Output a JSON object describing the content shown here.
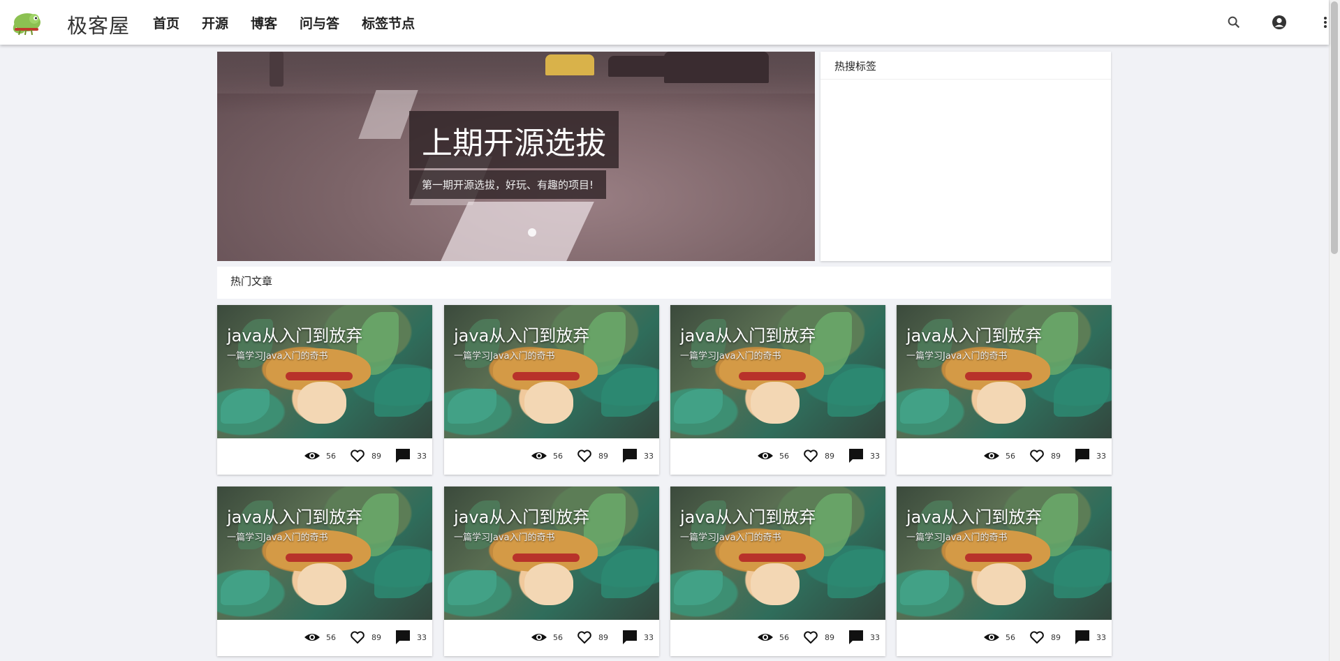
{
  "app": {
    "brand": "极客屋",
    "nav": [
      "首页",
      "开源",
      "博客",
      "问与答",
      "标签节点"
    ],
    "icons": [
      "search-icon",
      "account-circle-icon",
      "more-vert-icon"
    ]
  },
  "carousel": {
    "title": "上期开源选拔",
    "subtitle": "第一期开源选拔，好玩、有趣的项目!"
  },
  "hot_tags": {
    "title": "热搜标签"
  },
  "hot_articles": {
    "title": "热门文章",
    "cards": [
      {
        "title": "java从入门到放弃",
        "subtitle": "一篇学习Java入门的奇书",
        "views": "56",
        "likes": "89",
        "comments": "33"
      },
      {
        "title": "java从入门到放弃",
        "subtitle": "一篇学习Java入门的奇书",
        "views": "56",
        "likes": "89",
        "comments": "33"
      },
      {
        "title": "java从入门到放弃",
        "subtitle": "一篇学习Java入门的奇书",
        "views": "56",
        "likes": "89",
        "comments": "33"
      },
      {
        "title": "java从入门到放弃",
        "subtitle": "一篇学习Java入门的奇书",
        "views": "56",
        "likes": "89",
        "comments": "33"
      },
      {
        "title": "java从入门到放弃",
        "subtitle": "一篇学习Java入门的奇书",
        "views": "56",
        "likes": "89",
        "comments": "33"
      },
      {
        "title": "java从入门到放弃",
        "subtitle": "一篇学习Java入门的奇书",
        "views": "56",
        "likes": "89",
        "comments": "33"
      },
      {
        "title": "java从入门到放弃",
        "subtitle": "一篇学习Java入门的奇书",
        "views": "56",
        "likes": "89",
        "comments": "33"
      },
      {
        "title": "java从入门到放弃",
        "subtitle": "一篇学习Java入门的奇书",
        "views": "56",
        "likes": "89",
        "comments": "33"
      }
    ]
  },
  "colors": {
    "page_background": "#f1f2f6",
    "appbar": "#ffffff",
    "text": "#222222"
  }
}
